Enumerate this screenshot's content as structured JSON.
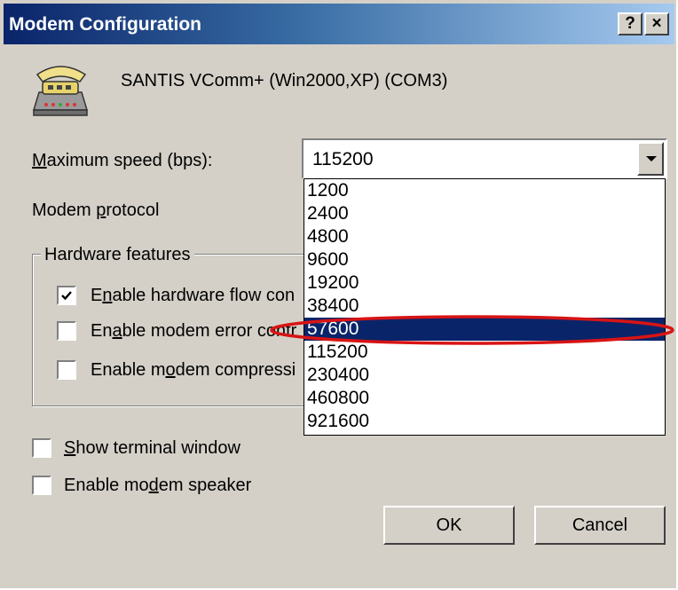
{
  "window": {
    "title": "Modem Configuration",
    "help_label": "?",
    "close_label": "×"
  },
  "device": {
    "name": "SANTIS VComm+ (Win2000,XP) (COM3)",
    "icon": "telephone-modem-icon"
  },
  "max_speed": {
    "label_pre": "",
    "label_key": "M",
    "label_post": "aximum speed (bps):",
    "value": "115200",
    "options": [
      "1200",
      "2400",
      "4800",
      "9600",
      "19200",
      "38400",
      "57600",
      "115200",
      "230400",
      "460800",
      "921600"
    ],
    "highlighted": "57600"
  },
  "modem_protocol": {
    "label_pre": "Modem ",
    "label_key": "p",
    "label_post": "rotocol"
  },
  "hardware": {
    "title": "Hardware features",
    "features": [
      {
        "label_pre": "E",
        "label_key": "n",
        "label_post": "able hardware flow con",
        "checked": true
      },
      {
        "label_pre": "En",
        "label_key": "a",
        "label_post": "ble modem error contr",
        "checked": false
      },
      {
        "label_pre": "Enable m",
        "label_key": "o",
        "label_post": "dem compressi",
        "checked": false
      }
    ]
  },
  "options": {
    "terminal": {
      "label_pre": "",
      "label_key": "S",
      "label_post": "how terminal window",
      "checked": false
    },
    "speaker": {
      "label_pre": "Enable mo",
      "label_key": "d",
      "label_post": "em speaker",
      "checked": false
    }
  },
  "buttons": {
    "ok": "OK",
    "cancel": "Cancel"
  },
  "colors": {
    "selection": "#0a246a",
    "annotation": "#d81414",
    "face": "#d4d0c8"
  }
}
